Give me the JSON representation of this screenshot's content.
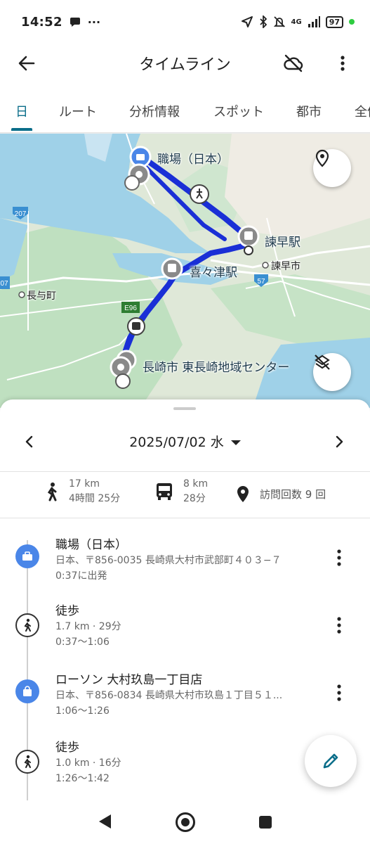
{
  "status": {
    "time": "14:52",
    "network": "4G",
    "battery": "97"
  },
  "appbar": {
    "title": "タイムライン"
  },
  "tabs": [
    {
      "label": "日",
      "active": true
    },
    {
      "label": "ルート",
      "active": false
    },
    {
      "label": "分析情報",
      "active": false
    },
    {
      "label": "スポット",
      "active": false
    },
    {
      "label": "都市",
      "active": false
    },
    {
      "label": "全体",
      "active": false
    }
  ],
  "map": {
    "labels": {
      "work": "職場（日本）",
      "isahaya_station": "諫早駅",
      "isahaya_city": "諫早市",
      "kikitsu_station": "喜々津駅",
      "nagayo": "長与町",
      "center": "長崎市 東長崎地域センター",
      "route207": "207",
      "route57": "57",
      "route7": "07",
      "e96": "E96"
    },
    "route_color": "#1a2fd6"
  },
  "sheet": {
    "date": "2025/07/02 水",
    "stats": {
      "walk": {
        "distance": "17 km",
        "duration": "4時間 25分"
      },
      "bus": {
        "distance": "8 km",
        "duration": "28分"
      },
      "visits": "訪問回数 9 回"
    },
    "entries": [
      {
        "type": "place",
        "icon": "briefcase-icon",
        "title": "職場（日本）",
        "sub1": "日本、〒856-0035 長崎県大村市武部町４０３−７",
        "sub2": "0:37に出発"
      },
      {
        "type": "walk",
        "icon": "walk-icon",
        "title": "徒歩",
        "sub1": "1.7 km · 29分",
        "sub2": "0:37〜1:06"
      },
      {
        "type": "place",
        "icon": "shopping-bag-icon",
        "title": "ローソン 大村玖島一丁目店",
        "sub1": "日本、〒856-0834 長崎県大村市玖島１丁目５１...",
        "sub2": "1:06〜1:26"
      },
      {
        "type": "walk",
        "icon": "walk-icon",
        "title": "徒歩",
        "sub1": "1.0 km · 16分",
        "sub2": "1:26〜1:42"
      }
    ]
  },
  "colors": {
    "accent": "#0b6e8a",
    "place_icon": "#4a86e8",
    "edit_icon": "#0b6e8a"
  }
}
